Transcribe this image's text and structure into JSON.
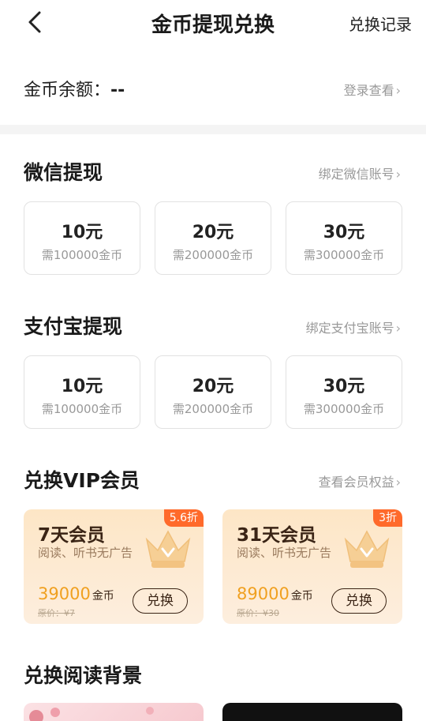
{
  "header": {
    "title": "金币提现兑换",
    "records_label": "兑换记录"
  },
  "balance": {
    "label": "金币余额：",
    "value": "--",
    "login_label": "登录查看"
  },
  "wechat": {
    "title": "微信提现",
    "link": "绑定微信账号",
    "options": [
      {
        "amount": "10元",
        "cost": "需100000金币"
      },
      {
        "amount": "20元",
        "cost": "需200000金币"
      },
      {
        "amount": "30元",
        "cost": "需300000金币"
      }
    ]
  },
  "alipay": {
    "title": "支付宝提现",
    "link": "绑定支付宝账号",
    "options": [
      {
        "amount": "10元",
        "cost": "需100000金币"
      },
      {
        "amount": "20元",
        "cost": "需200000金币"
      },
      {
        "amount": "30元",
        "cost": "需300000金币"
      }
    ]
  },
  "vip": {
    "title": "兑换VIP会员",
    "link": "查看会员权益",
    "plans": [
      {
        "name": "7天会员",
        "desc": "阅读、听书无广告",
        "discount": "5.6折",
        "price": "39000",
        "unit": "金币",
        "original": "原价：¥7",
        "button": "兑换"
      },
      {
        "name": "31天会员",
        "desc": "阅读、听书无广告",
        "discount": "3折",
        "price": "89000",
        "unit": "金币",
        "original": "原价：¥30",
        "button": "兑换"
      }
    ]
  },
  "backgrounds": {
    "title": "兑换阅读背景"
  },
  "colors": {
    "accent": "#f0a020",
    "discount": "#ff6a2b",
    "vip_bg": "#fde6c6"
  }
}
